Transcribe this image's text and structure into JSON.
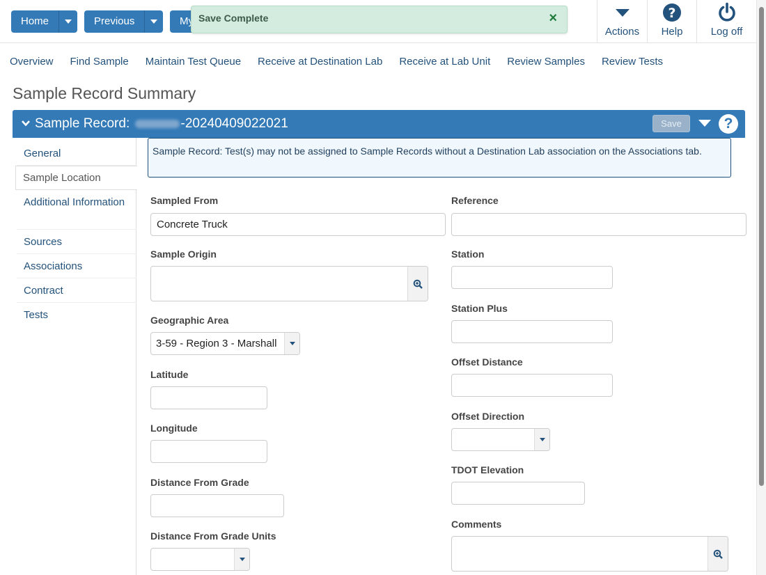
{
  "topbar": {
    "home_label": "Home",
    "previous_label": "Previous",
    "my_label": "My",
    "toast_message": "Save Complete",
    "toast_close": "×",
    "actions_label": "Actions",
    "help_label": "Help",
    "logoff_label": "Log off"
  },
  "tabs": [
    "Overview",
    "Find Sample",
    "Maintain Test Queue",
    "Receive at Destination Lab",
    "Receive at Lab Unit",
    "Review Samples",
    "Review Tests"
  ],
  "page_title": "Sample Record Summary",
  "panel": {
    "prefix": "Sample Record: ",
    "record_suffix": "-20240409022021",
    "save_label": "Save",
    "help_glyph": "?"
  },
  "sidebar": [
    "General",
    "Sample Location",
    "Additional Information",
    "Sources",
    "Associations",
    "Contract",
    "Tests"
  ],
  "alert": "Sample Record: Test(s) may not be assigned to Sample Records without a Destination Lab association on the Associations tab.",
  "form": {
    "sampled_from_label": "Sampled From",
    "sampled_from_value": "Concrete Truck",
    "sample_origin_label": "Sample Origin",
    "geographic_area_label": "Geographic Area",
    "geographic_area_value": "3-59 - Region 3 - Marshall",
    "latitude_label": "Latitude",
    "longitude_label": "Longitude",
    "distance_from_grade_label": "Distance From Grade",
    "distance_from_grade_units_label": "Distance From Grade Units",
    "reference_label": "Reference",
    "station_label": "Station",
    "station_plus_label": "Station Plus",
    "offset_distance_label": "Offset Distance",
    "offset_direction_label": "Offset Direction",
    "tdot_elevation_label": "TDOT Elevation",
    "comments_label": "Comments"
  },
  "colors": {
    "primary": "#337ab7",
    "link": "#23527c",
    "toast_bg": "#d4ece0"
  }
}
